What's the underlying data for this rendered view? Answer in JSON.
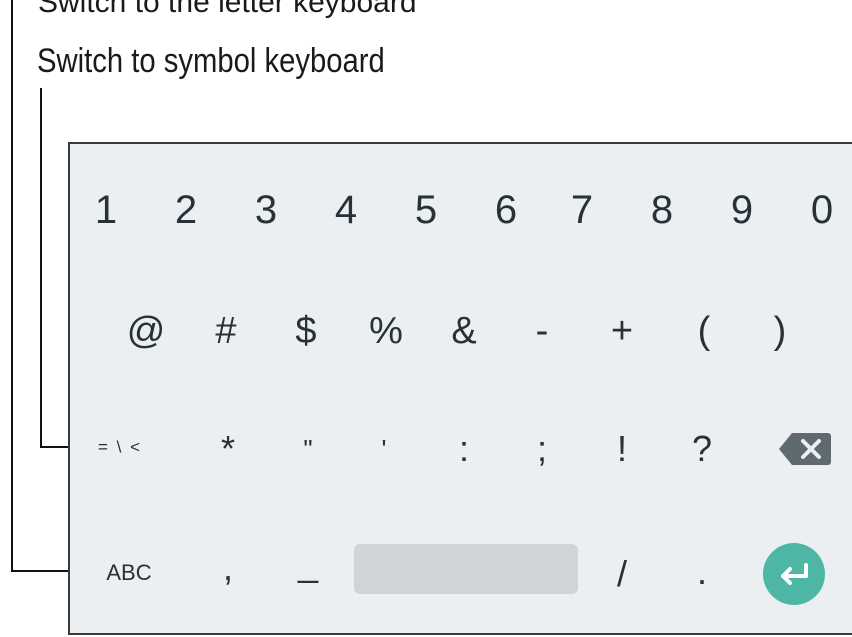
{
  "caption_top_clipped": "Switch to the letter keyboard",
  "caption": "Switch to symbol keyboard",
  "keyboard": {
    "row1": [
      "1",
      "2",
      "3",
      "4",
      "5",
      "6",
      "7",
      "8",
      "9",
      "0"
    ],
    "row2": [
      "@",
      "#",
      "$",
      "%",
      "&",
      "-",
      "+",
      "(",
      ")"
    ],
    "row3": {
      "switch_key": "= \\ <",
      "keys": [
        "*",
        "\"",
        "'",
        ":",
        ";",
        "!",
        "?"
      ],
      "backspace_icon": "backspace-icon"
    },
    "row4": {
      "abc_key": "ABC",
      "comma": ",",
      "underscore": "_",
      "slash": "/",
      "period": ".",
      "enter_icon": "enter-arrow-icon"
    },
    "colors": {
      "background": "#eceff1",
      "key_text": "#263238",
      "space_bar": "#cfd4d6",
      "enter": "#4db6a4",
      "backspace": "#5f6a70"
    }
  }
}
